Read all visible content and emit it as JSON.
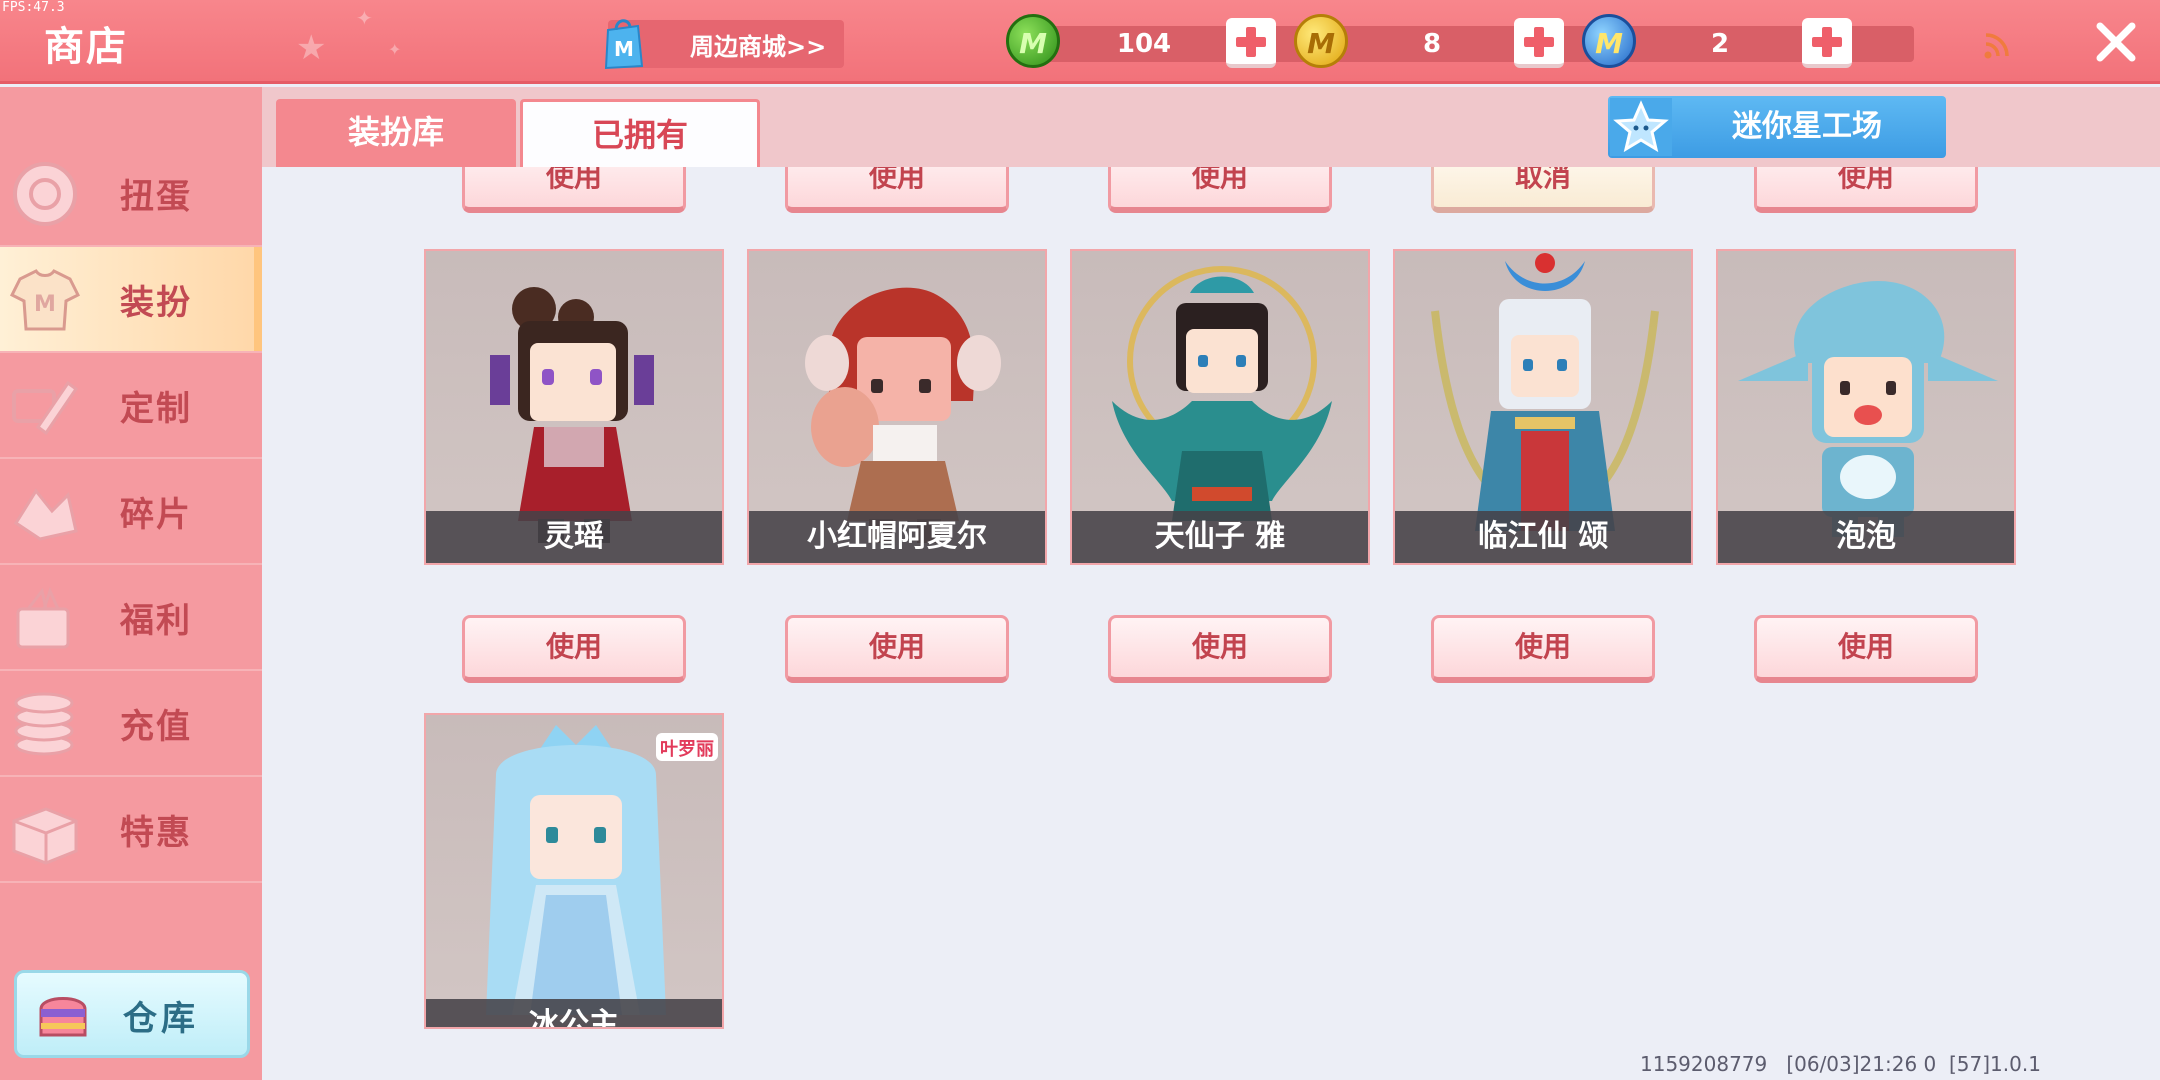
{
  "fps": "FPS:47.3",
  "header": {
    "title": "商店",
    "peripheral_button": "周边商城>>",
    "currencies": [
      {
        "icon": "green-m-coin-icon",
        "value": "104",
        "color": "#3fae2a"
      },
      {
        "icon": "gold-m-coin-icon",
        "value": "8",
        "color": "#f3c21b"
      },
      {
        "icon": "blue-m-coin-icon",
        "value": "2",
        "color": "#2f86e0"
      }
    ]
  },
  "sidebar": {
    "items": [
      {
        "label": "扭蛋",
        "icon": "gacha-icon",
        "active": false
      },
      {
        "label": "装扮",
        "icon": "outfit-shirt-icon",
        "active": true
      },
      {
        "label": "定制",
        "icon": "customize-pencil-icon",
        "active": false
      },
      {
        "label": "碎片",
        "icon": "fragment-icon",
        "active": false
      },
      {
        "label": "福利",
        "icon": "welfare-gift-icon",
        "active": false
      },
      {
        "label": "充值",
        "icon": "recharge-coins-icon",
        "active": false
      },
      {
        "label": "特惠",
        "icon": "special-offer-box-icon",
        "active": false
      }
    ],
    "warehouse_label": "仓库"
  },
  "tabs": {
    "library": "装扮库",
    "owned": "已拥有",
    "active": "owned"
  },
  "workshop_button": "迷你星工场",
  "top_row_buttons": [
    "使用",
    "使用",
    "使用",
    "取消",
    "使用"
  ],
  "cards": [
    {
      "name": "灵瑶",
      "button": "使用"
    },
    {
      "name": "小红帽阿夏尔",
      "button": "使用"
    },
    {
      "name": "天仙子 雅",
      "button": "使用"
    },
    {
      "name": "临江仙 颂",
      "button": "使用"
    },
    {
      "name": "泡泡",
      "button": "使用"
    },
    {
      "name": "冰公主",
      "badge": "叶罗丽"
    }
  ],
  "footer": "1159208779   [06/03]21:26 0  [57]1.0.1"
}
